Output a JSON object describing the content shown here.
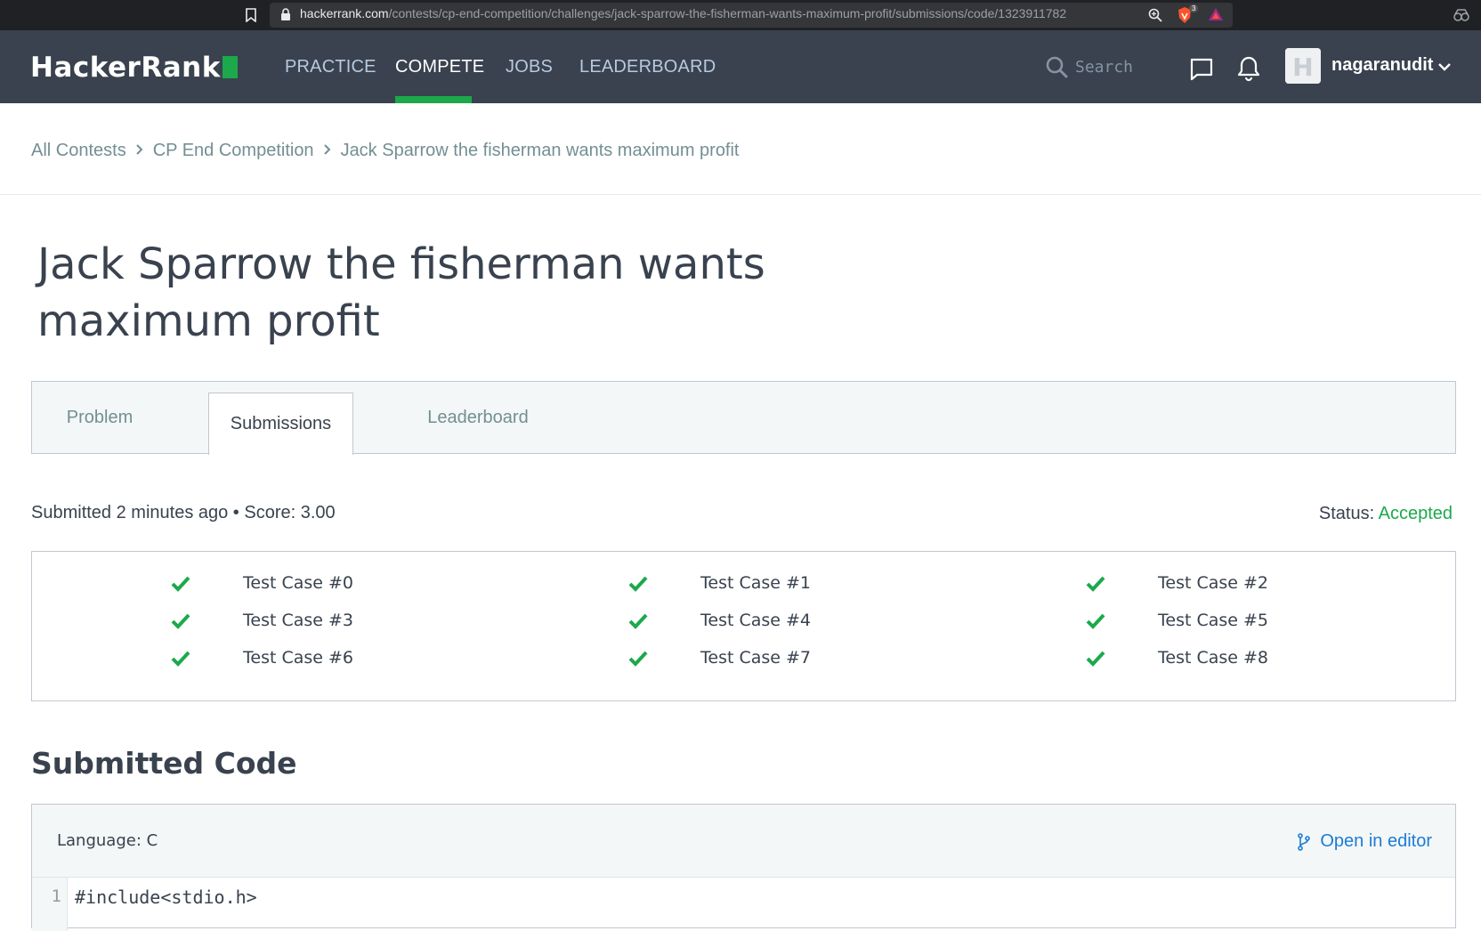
{
  "browser": {
    "url_host": "hackerrank.com",
    "url_path": "/contests/cp-end-competition/challenges/jack-sparrow-the-fisherman-wants-maximum-profit/submissions/code/1323911782",
    "brave_badge": "3",
    "icons": [
      "bookmark-icon",
      "lock-icon",
      "zoom-icon",
      "brave-shield-icon",
      "brave-rewards-icon",
      "extension-icon"
    ]
  },
  "header": {
    "logo_text": "HackerRank",
    "brand_color": "#1ba94c",
    "nav": [
      {
        "label": "PRACTICE",
        "active": false
      },
      {
        "label": "COMPETE",
        "active": true
      },
      {
        "label": "JOBS",
        "active": false
      },
      {
        "label": "LEADERBOARD",
        "active": false
      }
    ],
    "search_placeholder": "Search",
    "username": "nagaranudit",
    "avatar_letter": "H"
  },
  "breadcrumb": [
    {
      "label": "All Contests"
    },
    {
      "label": "CP End Competition"
    },
    {
      "label": "Jack Sparrow the fisherman wants maximum profit"
    }
  ],
  "page": {
    "title_line1": "Jack Sparrow the fisherman wants",
    "title_line2": "maximum profit"
  },
  "tabs": [
    {
      "label": "Problem",
      "active": false
    },
    {
      "label": "Submissions",
      "active": true
    },
    {
      "label": "Leaderboard",
      "active": false
    }
  ],
  "submission": {
    "submitted_text": "Submitted 2 minutes ago • Score: 3.00",
    "status_label": "Status:",
    "status_value": "Accepted",
    "status_color": "#1ba94c",
    "test_cases": [
      {
        "label": "Test Case #0",
        "passed": true
      },
      {
        "label": "Test Case #1",
        "passed": true
      },
      {
        "label": "Test Case #2",
        "passed": true
      },
      {
        "label": "Test Case #3",
        "passed": true
      },
      {
        "label": "Test Case #4",
        "passed": true
      },
      {
        "label": "Test Case #5",
        "passed": true
      },
      {
        "label": "Test Case #6",
        "passed": true
      },
      {
        "label": "Test Case #7",
        "passed": true
      },
      {
        "label": "Test Case #8",
        "passed": true
      }
    ]
  },
  "code": {
    "heading": "Submitted Code",
    "language": "Language: C",
    "open_in_editor": "Open in editor",
    "lines": [
      {
        "number": "1",
        "text": "#include<stdio.h>"
      }
    ]
  }
}
